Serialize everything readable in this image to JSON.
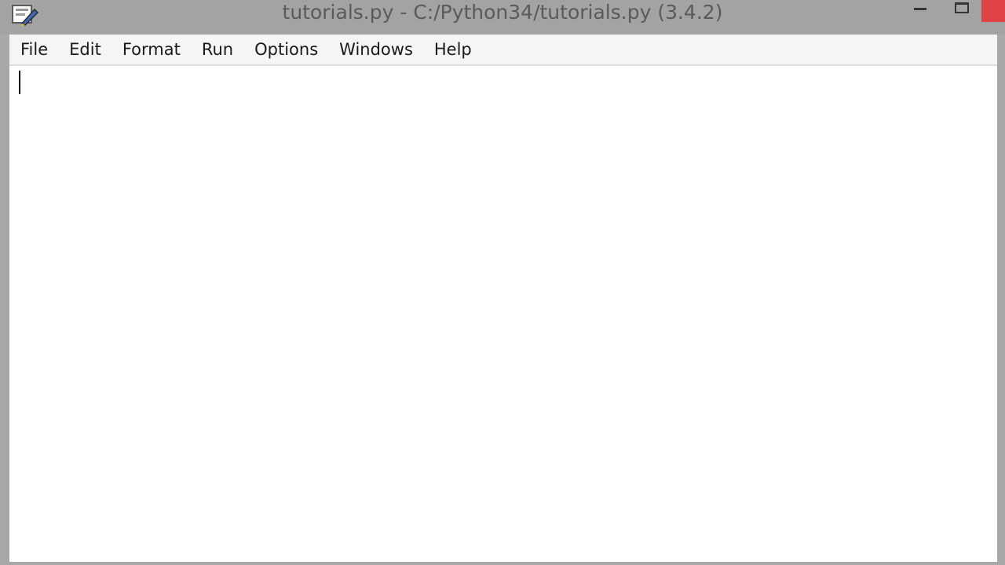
{
  "window": {
    "title": "tutorials.py - C:/Python34/tutorials.py (3.4.2)",
    "app_icon": "idle-python-icon",
    "controls": {
      "minimize_icon": "minimize-icon",
      "maximize_icon": "maximize-icon",
      "close_icon": "close-icon",
      "close_color": "#e04343"
    }
  },
  "menubar": {
    "items": [
      {
        "label": "File"
      },
      {
        "label": "Edit"
      },
      {
        "label": "Format"
      },
      {
        "label": "Run"
      },
      {
        "label": "Options"
      },
      {
        "label": "Windows"
      },
      {
        "label": "Help"
      }
    ]
  },
  "editor": {
    "content": ""
  }
}
